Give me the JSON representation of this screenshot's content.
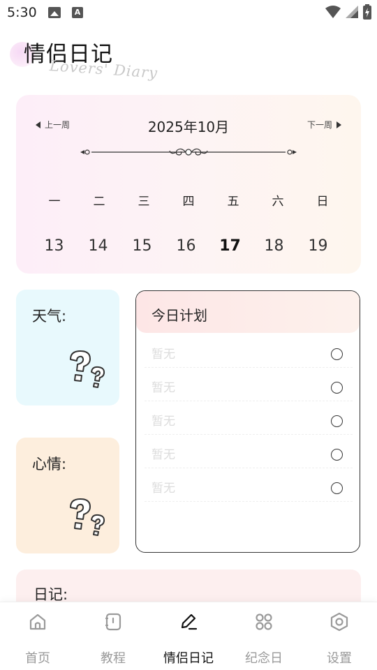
{
  "status_bar": {
    "time": "5:30"
  },
  "header": {
    "title": "情侣日记",
    "subtitle": "Lovers' Diary"
  },
  "calendar": {
    "prev_week": "上一周",
    "next_week": "下一周",
    "month": "2025年10月",
    "weekdays": [
      "一",
      "二",
      "三",
      "四",
      "五",
      "六",
      "日"
    ],
    "days": [
      "13",
      "14",
      "15",
      "16",
      "17",
      "18",
      "19"
    ],
    "today": "17"
  },
  "weather": {
    "label": "天气:",
    "icon": "question-marks-icon"
  },
  "mood": {
    "label": "心情:",
    "icon": "question-marks-icon"
  },
  "plan": {
    "title": "今日计划",
    "items": [
      "暂无",
      "暂无",
      "暂无",
      "暂无",
      "暂无"
    ]
  },
  "diary": {
    "label": "日记:"
  },
  "nav": {
    "items": [
      {
        "label": "首页",
        "icon": "home-icon"
      },
      {
        "label": "教程",
        "icon": "book-icon"
      },
      {
        "label": "情侣日记",
        "icon": "edit-icon"
      },
      {
        "label": "纪念日",
        "icon": "grid-icon"
      },
      {
        "label": "设置",
        "icon": "settings-icon"
      }
    ],
    "active": "情侣日记"
  },
  "colors": {
    "weather_bg": "#e8f9fd",
    "mood_bg": "#fdeedd",
    "diary_bg": "#fdefef",
    "active_nav": "#111111",
    "inactive_nav": "#9a9a9a"
  }
}
